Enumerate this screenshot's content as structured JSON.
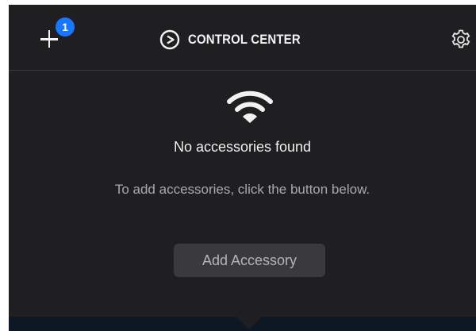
{
  "header": {
    "title": "CONTROL CENTER",
    "add_icon": "plus-icon",
    "badge_count": "1",
    "logo_icon": "elgato-logo-icon",
    "settings_icon": "gear-icon"
  },
  "main": {
    "status_icon": "wifi-icon",
    "empty_title": "No accessories found",
    "empty_message": "To add accessories, click the button below.",
    "add_button_label": "Add Accessory"
  },
  "colors": {
    "background": "#1f1f22",
    "badge": "#1976ff",
    "button": "#3a3a3e",
    "footer": "#0e1824"
  }
}
